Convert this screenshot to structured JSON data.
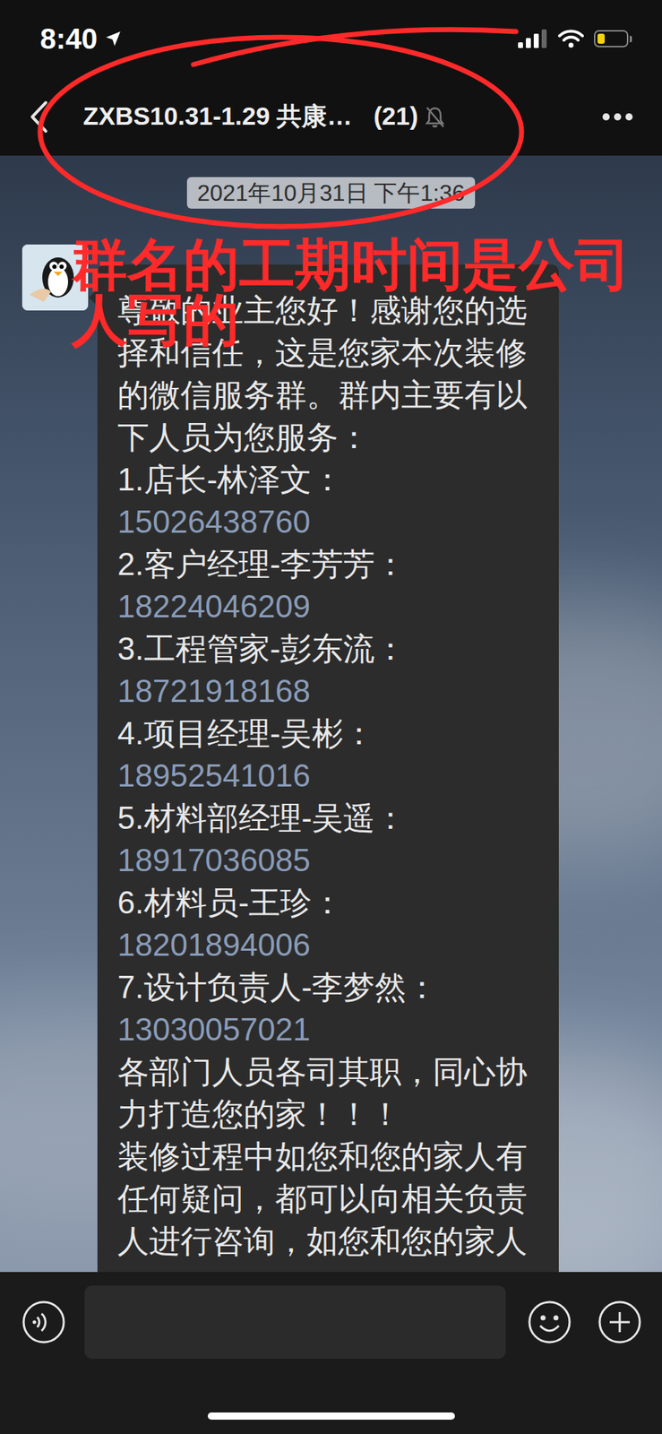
{
  "status_bar": {
    "time": "8:40",
    "battery_level": 0.25
  },
  "nav": {
    "title": "ZXBS10.31-1.29 共康…",
    "member_count": "(21)",
    "muted": true
  },
  "date": "2021年10月31日 下午1:36",
  "message": {
    "lines": [
      {
        "text": "尊敬的业主您好！感谢您的选",
        "kind": "text"
      },
      {
        "text": "择和信任，这是您家本次装修",
        "kind": "text"
      },
      {
        "text": "的微信服务群。群内主要有以",
        "kind": "text"
      },
      {
        "text": "下人员为您服务：",
        "kind": "text"
      },
      {
        "text": "1.店长-林泽文：",
        "kind": "text"
      },
      {
        "text": "15026438760",
        "kind": "phone"
      },
      {
        "text": "2.客户经理-李芳芳：",
        "kind": "text"
      },
      {
        "text": "18224046209",
        "kind": "phone"
      },
      {
        "text": "3.工程管家-彭东流：",
        "kind": "text"
      },
      {
        "text": "18721918168",
        "kind": "phone"
      },
      {
        "text": "4.项目经理-吴彬：",
        "kind": "text"
      },
      {
        "text": "18952541016",
        "kind": "phone"
      },
      {
        "text": "5.材料部经理-吴遥：",
        "kind": "text"
      },
      {
        "text": "18917036085",
        "kind": "phone"
      },
      {
        "text": "6.材料员-王珍：",
        "kind": "text"
      },
      {
        "text": "18201894006",
        "kind": "phone"
      },
      {
        "text": "7.设计负责人-李梦然：",
        "kind": "text"
      },
      {
        "text": "13030057021",
        "kind": "phone"
      },
      {
        "text": "各部门人员各司其职，同心协",
        "kind": "text"
      },
      {
        "text": "力打造您的家！！！",
        "kind": "text"
      },
      {
        "text": "装修过程中如您和您的家人有",
        "kind": "text"
      },
      {
        "text": "任何疑问，都可以向相关负责",
        "kind": "text"
      },
      {
        "text": "人进行咨询，如您和您的家人",
        "kind": "text"
      }
    ]
  },
  "annotation": {
    "text": "群名的工期时间是公司人写的"
  }
}
